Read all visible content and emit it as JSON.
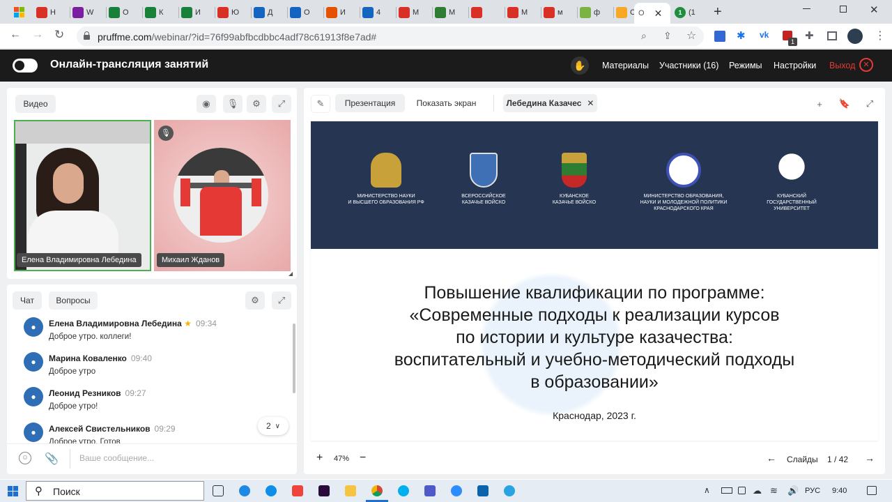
{
  "browser": {
    "tabs": [
      {
        "label": "Н",
        "color": "#d93025"
      },
      {
        "label": "W",
        "color": "#7b1fa2"
      },
      {
        "label": "О",
        "color": "#188038"
      },
      {
        "label": "К",
        "color": "#188038"
      },
      {
        "label": "И",
        "color": "#188038"
      },
      {
        "label": "Ю",
        "color": "#d93025"
      },
      {
        "label": "Д",
        "color": "#1565c0"
      },
      {
        "label": "О",
        "color": "#1565c0"
      },
      {
        "label": "И",
        "color": "#e65100"
      },
      {
        "label": "4",
        "color": "#1565c0"
      },
      {
        "label": "М",
        "color": "#d93025"
      },
      {
        "label": "М",
        "color": "#2e7d32"
      },
      {
        "label": "",
        "color": "#d93025"
      },
      {
        "label": "М",
        "color": "#d93025"
      },
      {
        "label": "м",
        "color": "#d93025"
      },
      {
        "label": "ф",
        "color": "#7cb342"
      },
      {
        "label": "О",
        "color": "#f9a825"
      }
    ],
    "active_tab": "О",
    "last_tab": "(1",
    "url_host": "pruffme.com",
    "url_path": "/webinar/?id=76f99abfbcdbbc4adf78c61913f8e7ad#",
    "ext_badge": "1"
  },
  "app": {
    "title": "Онлайн-трансляция занятий",
    "nav": {
      "materials": "Материалы",
      "participants": "Участники (16)",
      "modes": "Режимы",
      "settings": "Настройки",
      "exit": "Выход"
    }
  },
  "video": {
    "tab_label": "Видео",
    "participants": [
      {
        "name": "Елена Владимировна Лебедина"
      },
      {
        "name": "Михаил Жданов"
      }
    ]
  },
  "chat": {
    "tabs": [
      "Чат",
      "Вопросы"
    ],
    "messages": [
      {
        "name": "Елена Владимировна Лебедина",
        "time": "09:34",
        "text": "Доброе утро. коллеги!",
        "star": true
      },
      {
        "name": "Марина Коваленко",
        "time": "09:40",
        "text": "Доброе утро",
        "star": false
      },
      {
        "name": "Леонид Резников",
        "time": "09:27",
        "text": "Доброе утро!",
        "star": false
      },
      {
        "name": "Алексей Свистельников",
        "time": "09:29",
        "text": "Доброе утро. Готов",
        "star": false
      }
    ],
    "unread_count": "2",
    "input_placeholder": "Ваше сообщение..."
  },
  "presentation": {
    "tabs": {
      "presentation": "Презентация",
      "share_screen": "Показать экран",
      "current_file": "Лебедина Казачес"
    },
    "zoom": "47%",
    "slides_label": "Слайды",
    "slide_current": "1",
    "slide_total": "42",
    "slide": {
      "logos": [
        {
          "caption1": "МИНИСТЕРСТВО НАУКИ",
          "caption2": "И ВЫСШЕГО ОБРАЗОВАНИЯ РФ",
          "caption3": ""
        },
        {
          "caption1": "ВСЕРОССИЙСКОЕ",
          "caption2": "КАЗАЧЬЕ ВОЙСКО",
          "caption3": ""
        },
        {
          "caption1": "КУБАНСКОЕ",
          "caption2": "КАЗАЧЬЕ ВОЙСКО",
          "caption3": ""
        },
        {
          "caption1": "МИНИСТЕРСТВО ОБРАЗОВАНИЯ,",
          "caption2": "НАУКИ И МОЛОДЕЖНОЙ ПОЛИТИКИ",
          "caption3": "КРАСНОДАРСКОГО КРАЯ"
        },
        {
          "caption1": "КУБАНСКИЙ",
          "caption2": "ГОСУДАРСТВЕННЫЙ",
          "caption3": "УНИВЕРСИТЕТ"
        }
      ],
      "title_lines": [
        "Повышение квалификации по программе:",
        "«Современные подходы к реализации курсов",
        "по истории и культуре казачества:",
        "воспитательный и учебно-методический подходы",
        "в образовании»"
      ],
      "place_date": "Краснодар, 2023 г."
    }
  },
  "taskbar": {
    "search": "Поиск",
    "lang": "РУС",
    "time": "9:40"
  }
}
